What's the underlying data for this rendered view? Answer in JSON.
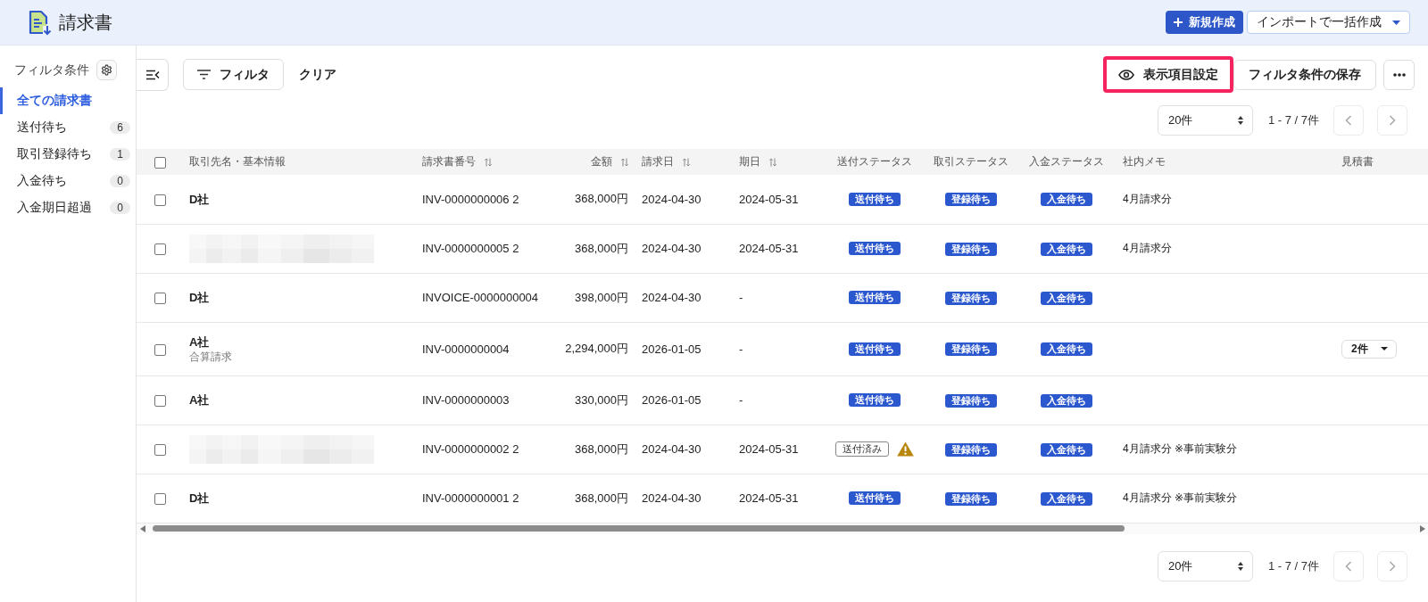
{
  "header": {
    "title": "請求書",
    "create_button": "新規作成",
    "import_button": "インポートで一括作成"
  },
  "sidebar": {
    "heading": "フィルタ条件",
    "items": [
      {
        "label": "全ての請求書",
        "selected": true
      },
      {
        "label": "送付待ち",
        "count": "6",
        "selected": false
      },
      {
        "label": "取引登録待ち",
        "count": "1",
        "selected": false
      },
      {
        "label": "入金待ち",
        "count": "0",
        "selected": false
      },
      {
        "label": "入金期日超過",
        "count": "0",
        "selected": false
      }
    ]
  },
  "toolbar": {
    "filter_button": "フィルタ",
    "clear_button": "クリア",
    "actions": [
      {
        "label": "表示項目設定",
        "kind": "view",
        "highlighted": true
      },
      {
        "label": "フィルタ条件の保存",
        "kind": "save",
        "highlighted": false
      }
    ]
  },
  "pagination_top": {
    "page_size": "20件",
    "range": "1 - 7 / 7件",
    "previous_disabled": true,
    "next_disabled": true
  },
  "table": {
    "select_all_checked": false,
    "columns": [
      {
        "label": "取引先名・基本情報",
        "sortable": false
      },
      {
        "label": "請求書番号",
        "sortable": true
      },
      {
        "label": "金額",
        "sortable": true
      },
      {
        "label": "請求日",
        "sortable": true
      },
      {
        "label": "期日",
        "sortable": true
      },
      {
        "label": "送付ステータス",
        "sortable": false
      },
      {
        "label": "取引ステータス",
        "sortable": false
      },
      {
        "label": "入金ステータス",
        "sortable": false
      },
      {
        "label": "社内メモ",
        "sortable": false
      },
      {
        "label": "見積書",
        "sortable": false
      }
    ],
    "rows": [
      {
        "checked": false,
        "client": {
          "name": "D社",
          "redacted": false
        },
        "number": "INV-0000000006 2",
        "amount": "368,000円",
        "issue_date": "2024-04-30",
        "due_date": "2024-05-31",
        "send_status": {
          "label": "送付待ち",
          "kind": "pending",
          "warning": false
        },
        "trade_status": "登録待ち",
        "payment_status": "入金待ち",
        "memo": "4月請求分"
      },
      {
        "checked": false,
        "client": {
          "redacted": true
        },
        "number": "INV-0000000005 2",
        "amount": "368,000円",
        "issue_date": "2024-04-30",
        "due_date": "2024-05-31",
        "send_status": {
          "label": "送付待ち",
          "kind": "pending",
          "warning": false
        },
        "trade_status": "登録待ち",
        "payment_status": "入金待ち",
        "memo": "4月請求分"
      },
      {
        "checked": false,
        "client": {
          "name": "D社",
          "redacted": false
        },
        "number": "INVOICE-0000000004",
        "amount": "398,000円",
        "issue_date": "2024-04-30",
        "due_date": "-",
        "send_status": {
          "label": "送付待ち",
          "kind": "pending",
          "warning": false
        },
        "trade_status": "登録待ち",
        "payment_status": "入金待ち"
      },
      {
        "checked": false,
        "client": {
          "name": "A社",
          "note": "合算請求",
          "redacted": false
        },
        "number": "INV-0000000004",
        "amount": "2,294,000円",
        "issue_date": "2026-01-05",
        "due_date": "-",
        "send_status": {
          "label": "送付待ち",
          "kind": "pending",
          "warning": false
        },
        "trade_status": "登録待ち",
        "payment_status": "入金待ち",
        "estimate": "2件"
      },
      {
        "checked": false,
        "client": {
          "name": "A社",
          "redacted": false
        },
        "number": "INV-0000000003",
        "amount": "330,000円",
        "issue_date": "2026-01-05",
        "due_date": "-",
        "send_status": {
          "label": "送付待ち",
          "kind": "pending",
          "warning": false
        },
        "trade_status": "登録待ち",
        "payment_status": "入金待ち"
      },
      {
        "checked": false,
        "client": {
          "redacted": true
        },
        "number": "INV-0000000002 2",
        "amount": "368,000円",
        "issue_date": "2024-04-30",
        "due_date": "2024-05-31",
        "send_status": {
          "label": "送付済み",
          "kind": "sent",
          "warning": true
        },
        "trade_status": "登録待ち",
        "payment_status": "入金待ち",
        "memo": "4月請求分 ※事前実験分"
      },
      {
        "checked": false,
        "client": {
          "name": "D社",
          "redacted": false
        },
        "number": "INV-0000000001 2",
        "amount": "368,000円",
        "issue_date": "2024-04-30",
        "due_date": "2024-05-31",
        "send_status": {
          "label": "送付待ち",
          "kind": "pending",
          "warning": false
        },
        "trade_status": "登録待ち",
        "payment_status": "入金待ち",
        "memo": "4月請求分 ※事前実験分"
      }
    ]
  },
  "pagination_bottom": {
    "page_size": "20件",
    "range": "1 - 7 / 7件",
    "previous_disabled": true,
    "next_disabled": true
  }
}
